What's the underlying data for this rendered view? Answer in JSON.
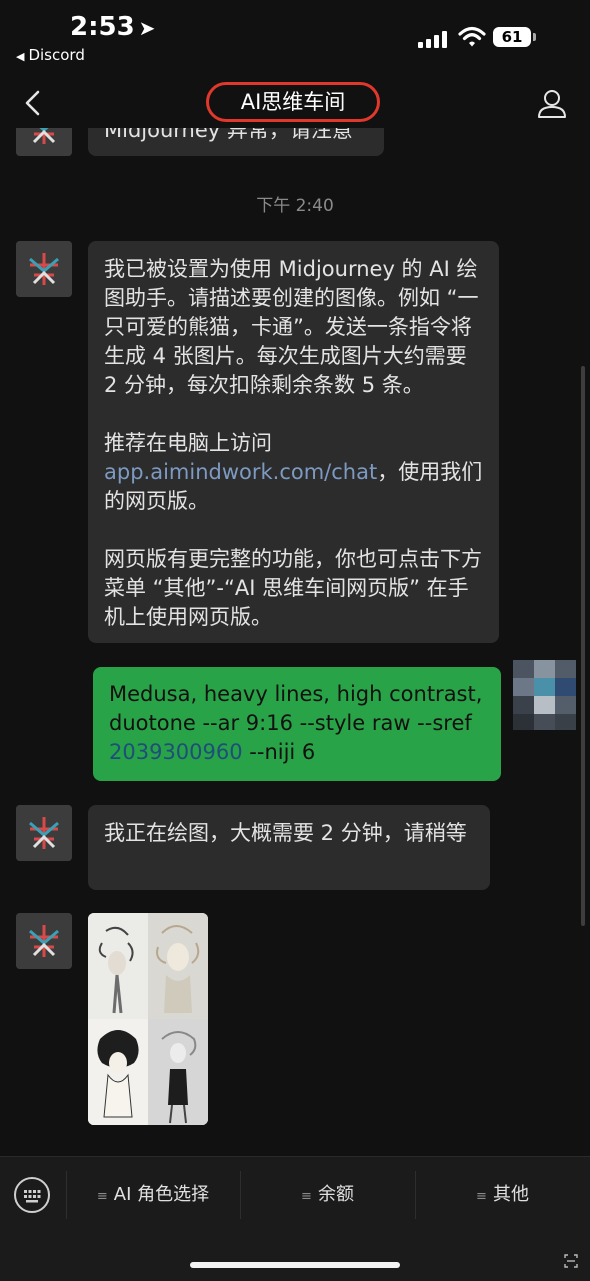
{
  "status_bar": {
    "time": "2:53",
    "back_app": "Discord",
    "battery": "61"
  },
  "nav": {
    "title": "AI思维车间"
  },
  "chat": {
    "truncated_message": "Midjourney 异常，请注意",
    "timestamp": "下午 2:40",
    "bot_intro": {
      "line1": "我已被设置为使用 Midjourney 的 AI 绘图助手。请描述要创建的图像。例如 “一只可爱的熊猫，卡通”。发送一条指令将生成 4 张图片。每次生成图片大约需要 2 分钟，每次扣除剩余条数 5 条。",
      "visit_prefix": "推荐在电脑上访问",
      "visit_link": "app.aimindwork.com/chat",
      "visit_suffix": "，使用我们的网页版。",
      "line3": "网页版有更完整的功能，你也可点击下方菜单 “其他”-“AI 思维车间网页版” 在手机上使用网页版。"
    },
    "user_message": {
      "prefix": "Medusa, heavy lines, high contrast, duotone --ar 9:16 --style raw --sref ",
      "link": "2039300960",
      "suffix": " --niji 6"
    },
    "bot_status": "我正在绘图，大概需要 2 分钟，请稍等"
  },
  "menu": {
    "items": [
      {
        "label": "AI 角色选择"
      },
      {
        "label": "余额"
      },
      {
        "label": "其他"
      }
    ]
  },
  "colors": {
    "background": "#111111",
    "bot_bubble": "#2c2c2c",
    "user_bubble": "#29a347",
    "title_highlight": "#e0382b",
    "link": "#7d9ac2"
  }
}
